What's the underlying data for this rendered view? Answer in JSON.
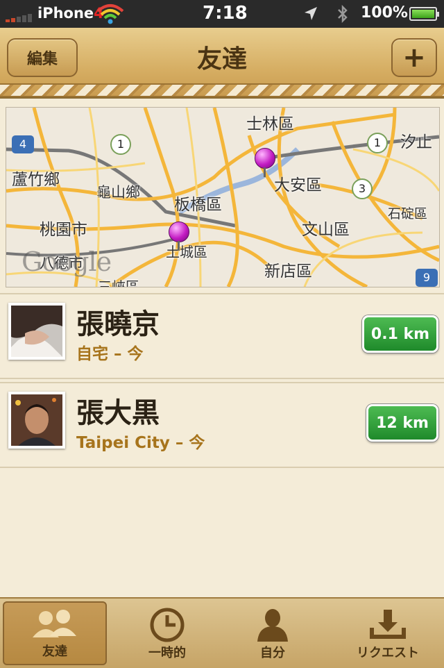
{
  "status_bar": {
    "carrier": "iPhone",
    "carrier_suffix": "4",
    "time": "7:18",
    "battery": "100%"
  },
  "nav": {
    "edit_label": "編集",
    "title": "友達",
    "add_label": "+"
  },
  "map": {
    "labels": [
      "士林區",
      "汐止",
      "蘆竹鄉",
      "龜山鄉",
      "板橋區",
      "大安區",
      "石碇區",
      "桃園市",
      "文山區",
      "土城區",
      "八德市",
      "新店區",
      "三峽區"
    ],
    "route_shields": [
      "4",
      "1",
      "1",
      "3",
      "9"
    ],
    "watermark": "Google"
  },
  "friends": [
    {
      "name": "張曉京",
      "location": "自宅 – 今",
      "distance": "0.1 km"
    },
    {
      "name": "張大黒",
      "location": "Taipei City – 今",
      "distance": "12 km"
    }
  ],
  "tabs": [
    {
      "label": "友達",
      "icon": "friends-icon",
      "active": true
    },
    {
      "label": "一時的",
      "icon": "clock-icon",
      "active": false
    },
    {
      "label": "自分",
      "icon": "person-icon",
      "active": false
    },
    {
      "label": "リクエスト",
      "icon": "inbox-download-icon",
      "active": false
    }
  ]
}
